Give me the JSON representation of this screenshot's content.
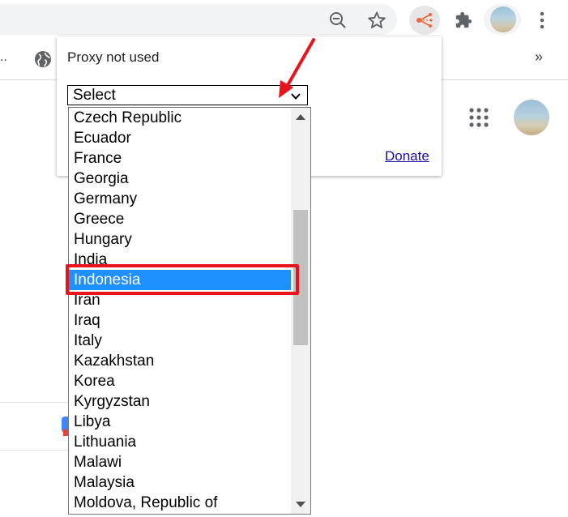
{
  "browser": {
    "icons": [
      "zoom-out-icon",
      "star-icon",
      "proxy-extension-icon",
      "extensions-puzzle-icon",
      "profile-avatar",
      "menu-dots-icon"
    ],
    "bookmarks_ellipsis": "..",
    "bookmarks_more": "»"
  },
  "popup": {
    "status": "Proxy not used",
    "select_value": "Select",
    "donate_label": "Donate"
  },
  "dropdown": {
    "items": [
      "Czech Republic",
      "Ecuador",
      "France",
      "Georgia",
      "Germany",
      "Greece",
      "Hungary",
      "India",
      "Indonesia",
      "Iran",
      "Iraq",
      "Italy",
      "Kazakhstan",
      "Korea",
      "Kyrgyzstan",
      "Libya",
      "Lithuania",
      "Malawi",
      "Malaysia",
      "Moldova, Republic of"
    ],
    "selected": "Indonesia"
  },
  "colors": {
    "selection": "#1e90ff",
    "annotation": "#e8141c",
    "link": "#1a0dab",
    "proxy_icon": "#f0643c"
  }
}
